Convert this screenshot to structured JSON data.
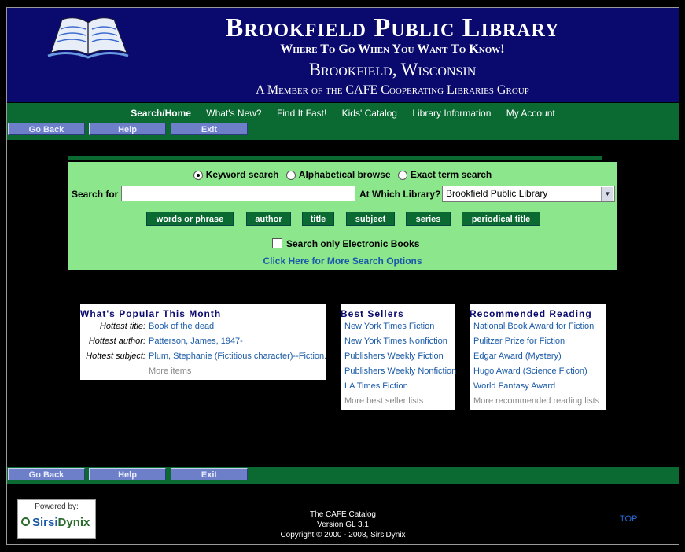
{
  "header": {
    "title": "Brookfield Public Library",
    "tagline": "Where To Go When You Want To Know!",
    "city": "Brookfield, Wisconsin",
    "member": "A Member of the CAFE Cooperating Libraries Group"
  },
  "nav": {
    "items": [
      "Search/Home",
      "What's New?",
      "Find It Fast!",
      "Kids' Catalog",
      "Library Information",
      "My Account"
    ]
  },
  "toolbar": {
    "back": "Go Back",
    "help": "Help",
    "exit": "Exit"
  },
  "search": {
    "radio_keyword": "Keyword search",
    "radio_alpha": "Alphabetical browse",
    "radio_exact": "Exact term search",
    "selected_radio": "keyword",
    "search_for_label": "Search for",
    "search_value": "",
    "library_label": "At Which Library?",
    "library_selected": "Brookfield Public Library",
    "buttons": [
      "words or phrase",
      "author",
      "title",
      "subject",
      "series",
      "periodical title"
    ],
    "ebooks_label": "Search only Electronic Books",
    "ebooks_checked": false,
    "more_options": "Click Here for More Search Options"
  },
  "popular": {
    "heading": "What's Popular This Month",
    "title_label": "Hottest title:",
    "title_value": "Book of the dead",
    "author_label": "Hottest author:",
    "author_value": "Patterson, James, 1947-",
    "subject_label": "Hottest subject:",
    "subject_value": "Plum, Stephanie (Fictitious character)--Fiction.",
    "more": "More items"
  },
  "bestsellers": {
    "heading": "Best Sellers",
    "items": [
      "New York Times Fiction",
      "New York Times Nonfiction",
      "Publishers Weekly Fiction",
      "Publishers Weekly Nonfiction",
      "LA Times Fiction"
    ],
    "more": "More best seller lists"
  },
  "recommended": {
    "heading": "Recommended Reading",
    "items": [
      "National Book Award for Fiction",
      "Pulitzer Prize for Fiction",
      "Edgar Award (Mystery)",
      "Hugo Award (Science Fiction)",
      "World Fantasy Award"
    ],
    "more": "More recommended reading lists"
  },
  "footer": {
    "powered_by": "Powered by:",
    "logo_a": "Sirsi",
    "logo_b": "Dynix",
    "line1": "The CAFE Catalog",
    "line2": "Version GL 3.1",
    "line3": "Copyright © 2000 - 2008, SirsiDynix",
    "top": "TOP"
  },
  "colors": {
    "navy": "#0a0a6e",
    "green": "#0a6a32",
    "search_bg": "#8ce68c",
    "link": "#1a5aa8"
  }
}
